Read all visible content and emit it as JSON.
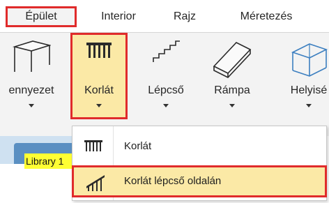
{
  "tabs": [
    {
      "label": "Épület",
      "active": true
    },
    {
      "label": "Interior"
    },
    {
      "label": "Rajz"
    },
    {
      "label": "Méretezés"
    }
  ],
  "ribbon": {
    "buttons": [
      {
        "label": "ennyezet",
        "icon": "ceiling-icon"
      },
      {
        "label": "Korlát",
        "icon": "railing-icon",
        "selected": true
      },
      {
        "label": "Lépcső",
        "icon": "stairs-icon"
      },
      {
        "label": "Rámpa",
        "icon": "ramp-icon"
      },
      {
        "label": "Helyisé",
        "icon": "room-icon"
      }
    ]
  },
  "library_tab": {
    "label": "Library 1"
  },
  "dropdown": {
    "items": [
      {
        "label": "Korlát",
        "icon": "railing-icon"
      },
      {
        "label": "Korlát lépcső oldalán",
        "icon": "stair-railing-icon",
        "highlighted": true
      }
    ]
  },
  "colors": {
    "highlight_border": "#e02b2b",
    "selected_fill": "#fbe9a6",
    "ribbon_bg": "#f3f3f3",
    "library_tab": "#ffff33"
  }
}
